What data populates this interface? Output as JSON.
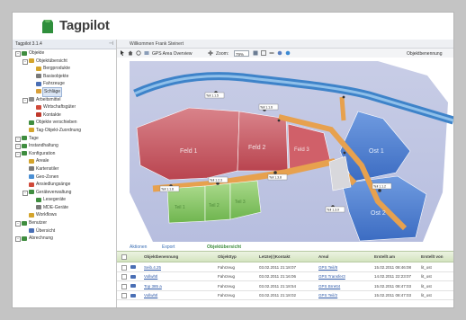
{
  "app": {
    "name": "Tagpilot"
  },
  "tree": {
    "header": "Tagpilot 3.1.4",
    "pin_icon": "pin-icon",
    "rows": [
      {
        "label": "Objekte",
        "icon": "folder-icon",
        "color": "#3f8d3f"
      },
      {
        "label": "Objektübersicht",
        "icon": "folder-icon",
        "color": "#d4a42c"
      },
      {
        "label": "Bergprodukte",
        "icon": "list-icon",
        "color": "#d4a42c"
      },
      {
        "label": "Basisobjekte",
        "icon": "list-icon",
        "color": "#7a7a7a"
      },
      {
        "label": "Fahrzeuge",
        "icon": "vehicle-icon",
        "color": "#4a6fb5"
      },
      {
        "label": "Schläge",
        "icon": "field-icon",
        "color": "#d9a03a"
      },
      {
        "label": "Arbeitsmittel",
        "icon": "tool-icon",
        "color": "#8a8a8a"
      },
      {
        "label": "Wirtschaftsgüter",
        "icon": "goods-icon",
        "color": "#d04a3a"
      },
      {
        "label": "Kontakte",
        "icon": "contact-icon",
        "color": "#c0392b"
      },
      {
        "label": "Objekte verschieben",
        "icon": "move-icon",
        "color": "#3f8d3f"
      },
      {
        "label": "Tag-Objekt-Zuordnung",
        "icon": "assign-icon",
        "color": "#d4a42c"
      },
      {
        "label": "Tage",
        "icon": "days-icon",
        "color": "#3f8d3f"
      },
      {
        "label": "Instandhaltung",
        "icon": "maintenance-icon",
        "color": "#3f8d3f"
      },
      {
        "label": "Konfiguration",
        "icon": "config-icon",
        "color": "#3f8d3f"
      },
      {
        "label": "Areale",
        "icon": "area-icon",
        "color": "#d4a42c"
      },
      {
        "label": "Kartenstiler",
        "icon": "map-style-icon",
        "color": "#7a7a7a"
      },
      {
        "label": "Geo-Zonen",
        "icon": "geozone-icon",
        "color": "#4a8fd4"
      },
      {
        "label": "Ansiedlungsänge",
        "icon": "settle-icon",
        "color": "#d04a3a"
      },
      {
        "label": "Geräteverwaltung",
        "icon": "devices-icon",
        "color": "#3f8d3f"
      },
      {
        "label": "Lesegeräte",
        "icon": "reader-icon",
        "color": "#3f8d3f"
      },
      {
        "label": "MDE-Geräte",
        "icon": "mde-icon",
        "color": "#7a7a7a"
      },
      {
        "label": "Workflows",
        "icon": "workflow-icon",
        "color": "#d4a42c"
      },
      {
        "label": "Benutzer",
        "icon": "users-icon",
        "color": "#3f8d3f"
      },
      {
        "label": "Übersicht",
        "icon": "overview-icon",
        "color": "#4a6fb5"
      },
      {
        "label": "Abrechnung",
        "icon": "billing-icon",
        "color": "#3f8d3f"
      }
    ]
  },
  "main": {
    "title_row": "Willkommen Frank Steinert",
    "toolbar": {
      "gps_label": "GPS Area Overview",
      "zoom_label": "Zoom:",
      "zoom_value": "79%",
      "right_label": "Objektbenennung"
    },
    "map": {
      "fields": [
        "Feld 1",
        "Feld 2",
        "Feld 3",
        "Ost 1",
        "Ost 2",
        "Teil 1",
        "Teil 2",
        "Teil 3"
      ],
      "labels": [
        "Teil 1.1.5",
        "Teil 1.1.6",
        "Teil 1.1.8",
        "Teil 1.2.3",
        "Teil 1.3.8",
        "Teil 1.3.9",
        "Teil 1.1.2"
      ]
    },
    "grid": {
      "actions": [
        "Aktionen",
        "Export",
        "Objektübersicht"
      ],
      "columns": [
        "Objektbenennung",
        "Objekttyp",
        "Letzte(r)Kontakt",
        "Areal",
        "Erstellt am",
        "Erstellt von"
      ],
      "rows": [
        {
          "name": "Seib.4.25",
          "type": "Fahrzeug",
          "contact": "03.02.2011 21:18:07",
          "area": "GPS Teil/8",
          "created": "15.02.2011 08:46:08",
          "by": "lit_ost"
        },
        {
          "name": "Vollwhtl",
          "type": "Fahrzeug",
          "contact": "03.02.2011 21:16:06",
          "area": "GPS Transfer3",
          "created": "14.02.2011 22:23:07",
          "by": "lit_ost"
        },
        {
          "name": "Top 385 a",
          "type": "Fahrzeug",
          "contact": "03.02.2011 21:18:54",
          "area": "GPS Brrett4",
          "created": "15.02.2011 08:47:03",
          "by": "lit_ost"
        },
        {
          "name": "Vollwhtl",
          "type": "Fahrzeug",
          "contact": "03.02.2011 21:18:02",
          "area": "GPS Teil/2",
          "created": "15.02.2011 08:47:03",
          "by": "lit_ost"
        }
      ]
    }
  },
  "colors": {
    "brand": "#2f8f3c",
    "link": "#2f5aa8",
    "grid_header": "#d4e4bf"
  }
}
